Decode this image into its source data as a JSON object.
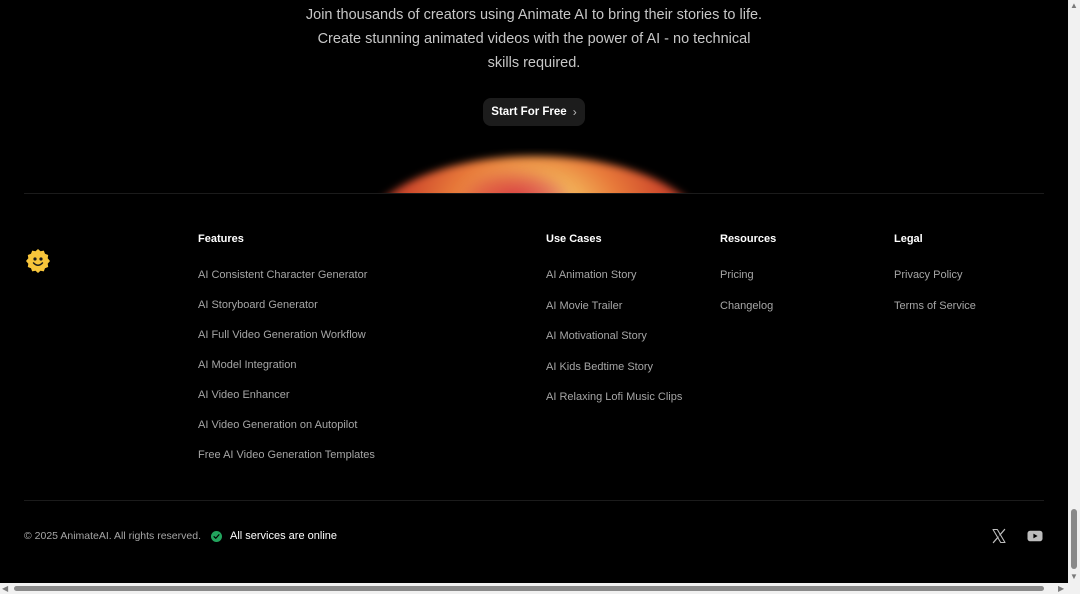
{
  "cta": {
    "line1": "Join thousands of creators using Animate AI to bring their stories to life.",
    "line2": "Create stunning animated videos with the power of AI - no technical",
    "line3": "skills required.",
    "button_label": "Start For Free"
  },
  "footer": {
    "features": {
      "title": "Features",
      "links": [
        "AI Consistent Character Generator",
        "AI Storyboard Generator",
        "AI Full Video Generation Workflow",
        "AI Model Integration",
        "AI Video Enhancer",
        "AI Video Generation on Autopilot",
        "Free AI Video Generation Templates"
      ]
    },
    "use_cases": {
      "title": "Use Cases",
      "links": [
        "AI Animation Story",
        "AI Movie Trailer",
        "AI Motivational Story",
        "AI Kids Bedtime Story",
        "AI Relaxing Lofi Music Clips"
      ]
    },
    "resources": {
      "title": "Resources",
      "links": [
        "Pricing",
        "Changelog"
      ]
    },
    "legal": {
      "title": "Legal",
      "links": [
        "Privacy Policy",
        "Terms of Service"
      ]
    },
    "copyright": "© 2025 AnimateAI. All rights reserved.",
    "status": "All services are online",
    "social": [
      "x-icon",
      "youtube-icon"
    ]
  },
  "colors": {
    "background": "#000000",
    "status_green": "#22a45d",
    "link_gray": "#a6a6a6",
    "logo_yellow": "#f7c53b"
  }
}
